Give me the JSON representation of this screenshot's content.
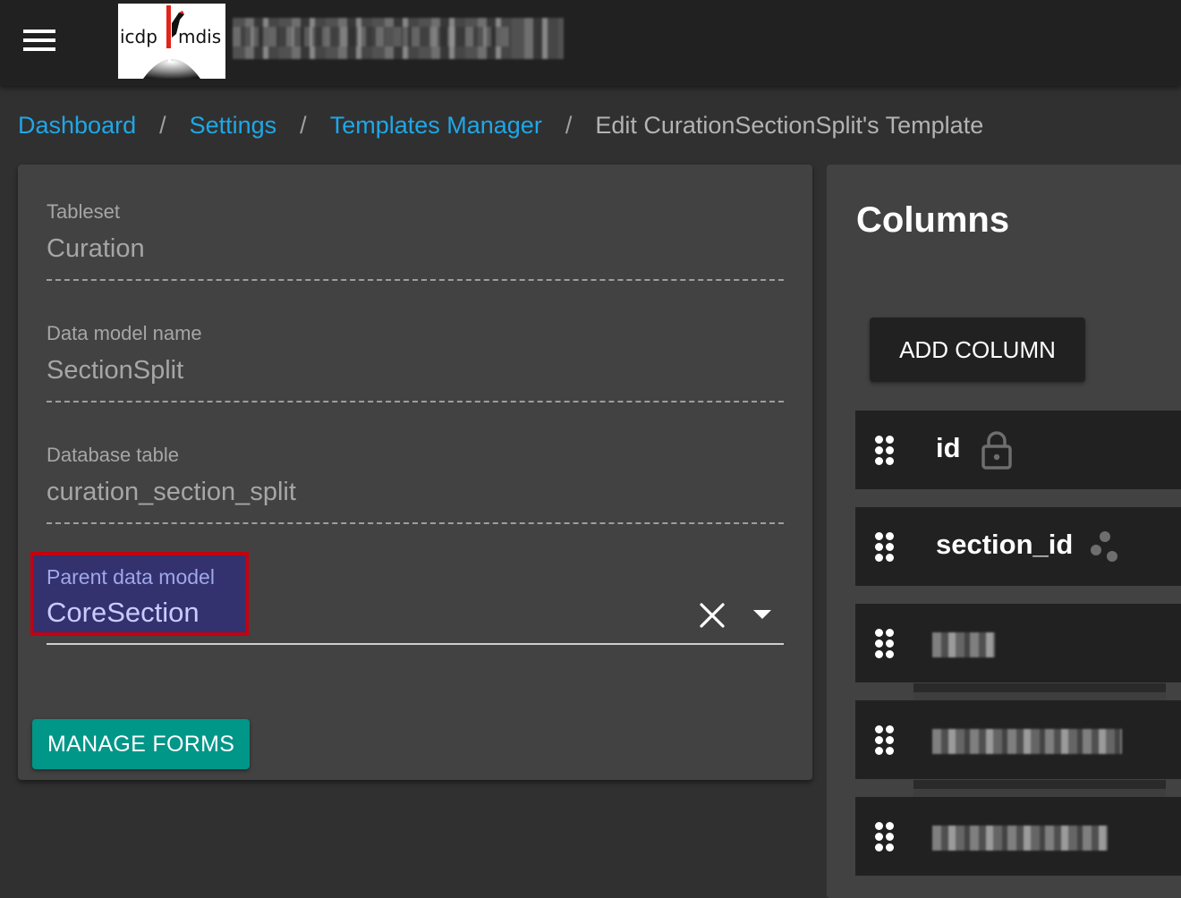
{
  "appbar": {
    "menu_icon": "hamburger-menu-icon",
    "logo": {
      "text_left": "icdp",
      "text_right": "mdis",
      "icon": "woodpecker-logo-icon"
    },
    "title_redacted": true
  },
  "breadcrumb": {
    "items": [
      {
        "label": "Dashboard",
        "link": true
      },
      {
        "label": "Settings",
        "link": true
      },
      {
        "label": "Templates Manager",
        "link": true
      },
      {
        "label": "Edit CurationSectionSplit's Template",
        "link": false
      }
    ],
    "separator": "/"
  },
  "form": {
    "tableset": {
      "label": "Tableset",
      "value": "Curation"
    },
    "data_model_name": {
      "label": "Data model name",
      "value": "SectionSplit"
    },
    "database_table": {
      "label": "Database table",
      "value": "curation_section_split"
    },
    "parent_data_model": {
      "label": "Parent data model",
      "value": "CoreSection",
      "clear_icon": "close-icon",
      "dropdown_icon": "arrow-drop-down-icon"
    },
    "manage_forms_label": "MANAGE FORMS"
  },
  "columns_panel": {
    "title": "Columns",
    "add_column_label": "ADD COLUMN",
    "items": [
      {
        "name": "id",
        "icon": "lock-icon",
        "redacted": false
      },
      {
        "name": "section_id",
        "icon": "foreign-key-icon",
        "redacted": false
      },
      {
        "name": "",
        "icon": "",
        "redacted": true
      },
      {
        "name": "",
        "icon": "",
        "redacted": true
      },
      {
        "name": "",
        "icon": "",
        "redacted": true
      }
    ]
  },
  "colors": {
    "accent_link": "#1ea7e8",
    "primary_button": "#009688",
    "highlight_bg": "#33316e",
    "highlight_border": "#c40010",
    "card_bg": "#424242",
    "appbar_bg": "#212121"
  }
}
